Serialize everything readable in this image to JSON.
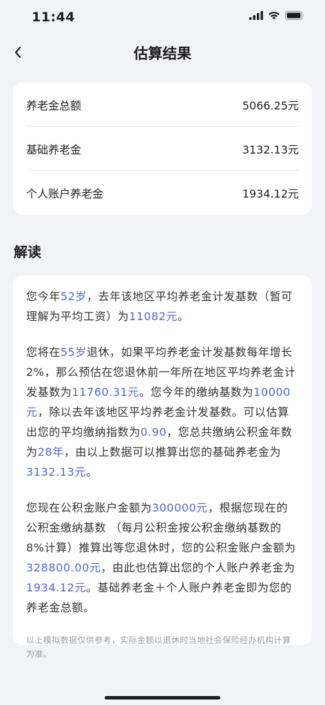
{
  "status_bar": {
    "time": "11:44"
  },
  "nav": {
    "title": "估算结果"
  },
  "summary": {
    "rows": [
      {
        "label": "养老金总额",
        "value": "5066.25元"
      },
      {
        "label": "基础养老金",
        "value": "3132.13元"
      },
      {
        "label": "个人账户养老金",
        "value": "1934.12元"
      }
    ]
  },
  "section": {
    "title": "解读"
  },
  "explanation": {
    "p1": [
      "您今年",
      "52岁",
      "，去年该地区平均养老金计发基数（暂可理解为平均工资）为",
      "11082元",
      "。"
    ],
    "p2": [
      "您将在",
      "55岁",
      "退休，如果平均养老金计发基数每年增长2%，那么预估在您退休前一年所在地区平均养老金计发基数为",
      "11760.31元",
      "。您今年的缴纳基数为",
      "10000元",
      "，除以去年该地区平均养老金计发基数。可以估算出您的平均缴纳指数为",
      "0.90",
      "，您总共缴纳公积金年数为",
      "28年",
      "，由以上数据可以推算出您的基础养老金为",
      "3132.13元",
      "。"
    ],
    "p3": [
      "您现在公积金账户金额为",
      "300000元",
      "，根据您现在的公积金缴纳基数 （每月公积金按公积金缴纳基数的8%计算）推算出等您退休时，您的公积金账户金额为",
      "328800.00元",
      "，由此也估算出您的个人账户养老金为",
      "1934.12元",
      "。基础养老金＋个人账户养老金即为您的养老金总额。"
    ],
    "note": "以上模拟数据仅供参考，实际金额以退休时当地社会保险经办机构计算为准。"
  },
  "colors": {
    "highlight": "#4f67d6",
    "background": "#f2f3f7"
  },
  "icons": [
    "cellular-signal-icon",
    "wifi-icon",
    "battery-icon",
    "back-chevron-icon"
  ]
}
